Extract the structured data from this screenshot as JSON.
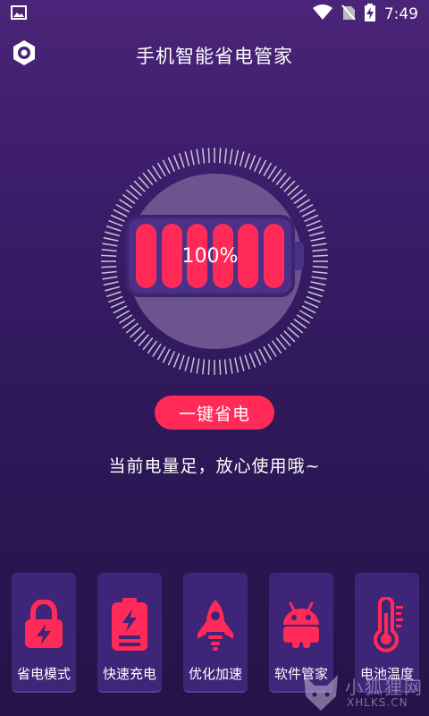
{
  "status_bar": {
    "time": "7:49",
    "icons": [
      "image-icon",
      "wifi-icon",
      "no-sim-icon",
      "battery-charging-icon"
    ]
  },
  "header": {
    "title": "手机智能省电管家",
    "settings_icon": "gear-hex-icon"
  },
  "battery": {
    "level_text": "100%",
    "level": 1.0,
    "cells": 6
  },
  "actions": {
    "primary_label": "一键省电"
  },
  "message": "当前电量足，放心使用哦~",
  "features": [
    {
      "label": "省电模式",
      "icon": "lock-bolt-icon"
    },
    {
      "label": "快速充电",
      "icon": "battery-bolt-icon"
    },
    {
      "label": "优化加速",
      "icon": "rocket-icon"
    },
    {
      "label": "软件管家",
      "icon": "android-icon"
    },
    {
      "label": "电池温度",
      "icon": "thermometer-icon"
    }
  ],
  "watermark": {
    "main": "小狐狸网",
    "sub": "XHLKS.CN"
  },
  "colors": {
    "accent": "#ff2a57",
    "background_top": "#4a2478",
    "background_bottom": "#241448",
    "card": "#3f2578"
  }
}
